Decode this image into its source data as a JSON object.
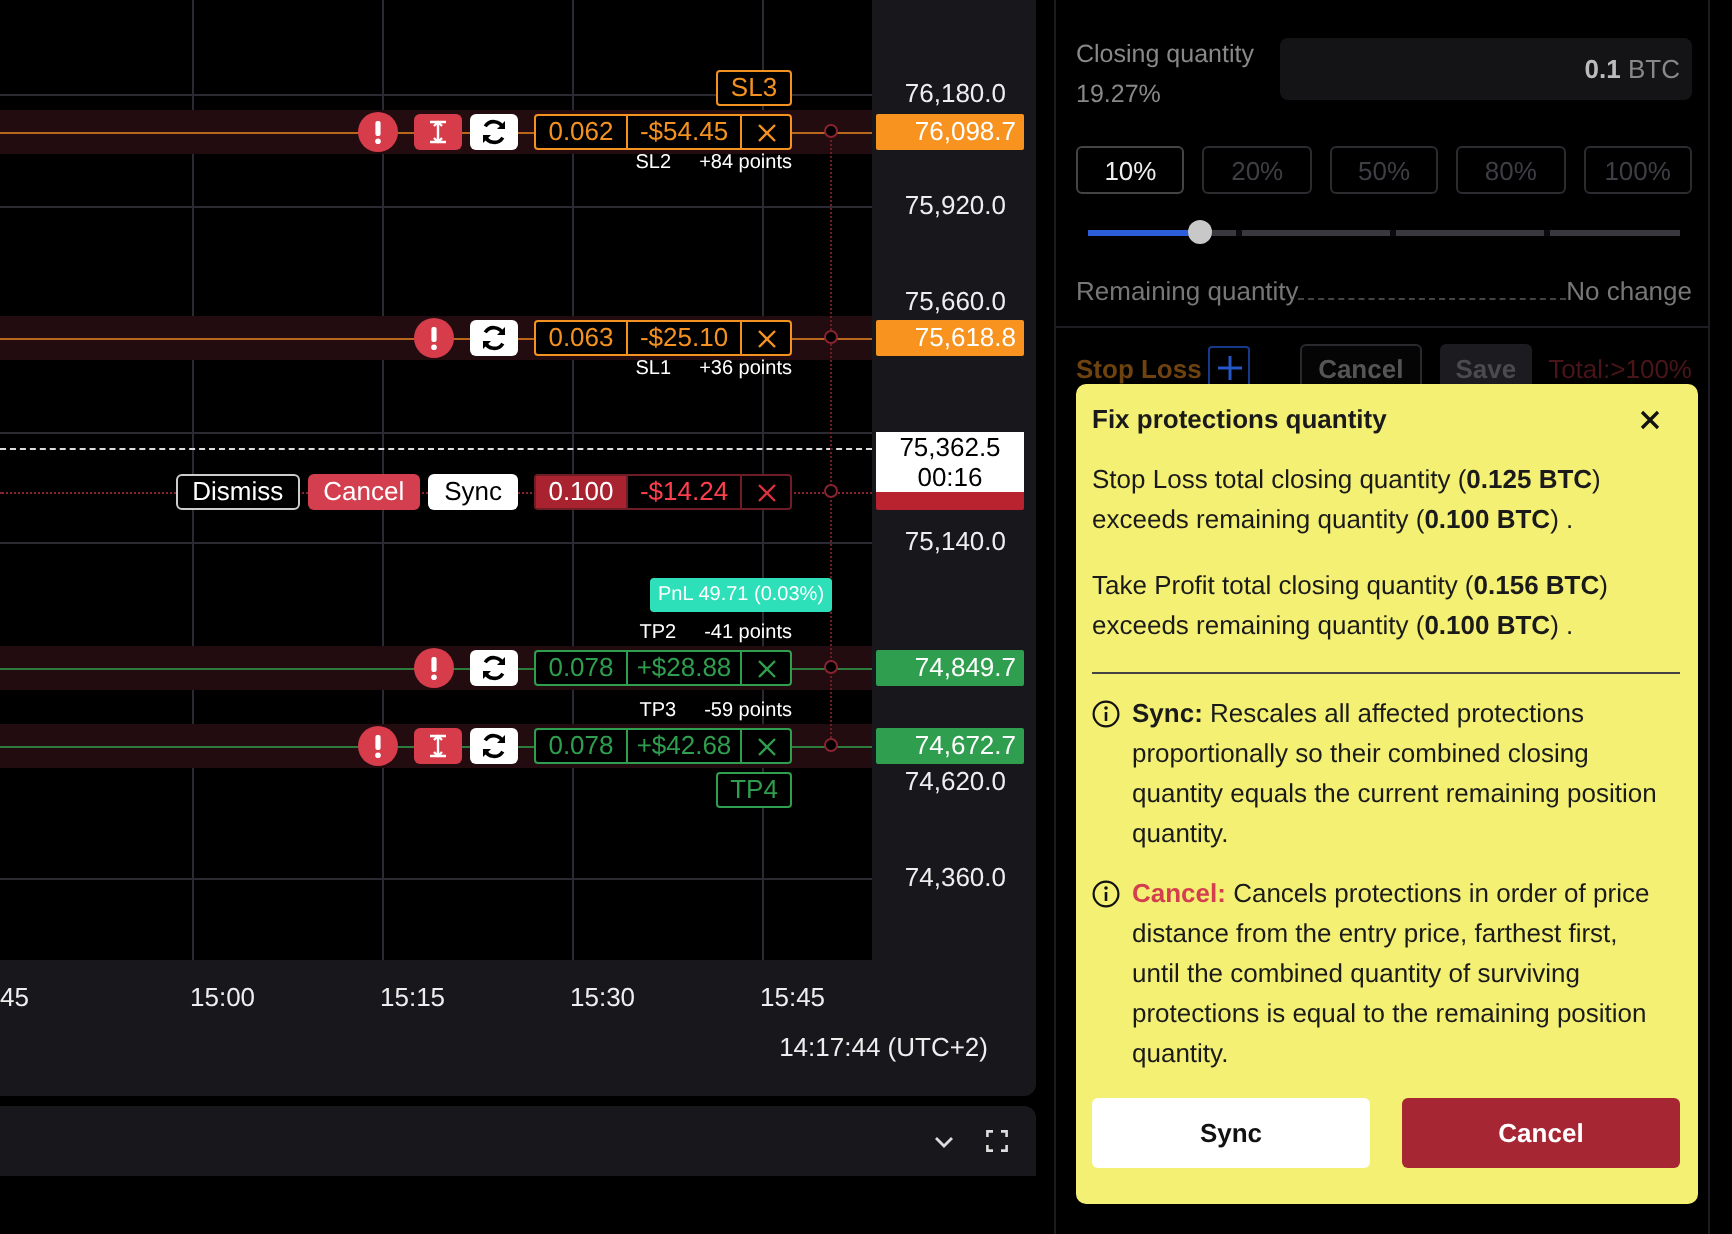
{
  "chart": {
    "price_ticks": [
      "76,180.0",
      "75,920.0",
      "75,660.0",
      "75,140.0",
      "74,620.0",
      "74,360.0"
    ],
    "time_ticks": [
      "45",
      "15:00",
      "15:15",
      "15:30",
      "15:45"
    ],
    "clock": "14:17:44 (UTC+2)",
    "current_price": {
      "price": "75,362.5",
      "countdown": "00:16"
    },
    "pnl_badge": "PnL 49.71 (0.03%)",
    "pending_tags": [
      {
        "kind": "stop_loss",
        "label": "SL3"
      },
      {
        "kind": "take_profit",
        "label": "TP4"
      }
    ],
    "orders": [
      {
        "kind": "stop_loss",
        "name": "SL2",
        "points": "+84 points",
        "quantity": "0.062",
        "pnl": "-$54.45",
        "price": "76,098.7",
        "warning": true,
        "range_button": true
      },
      {
        "kind": "stop_loss",
        "name": "SL1",
        "points": "+36 points",
        "quantity": "0.063",
        "pnl": "-$25.10",
        "price": "75,618.8",
        "warning": true,
        "range_button": false
      },
      {
        "kind": "take_profit",
        "name": "TP2",
        "points": "-41 points",
        "quantity": "0.078",
        "pnl": "+$28.88",
        "price": "74,849.7",
        "warning": true,
        "range_button": false
      },
      {
        "kind": "take_profit",
        "name": "TP3",
        "points": "-59 points",
        "quantity": "0.078",
        "pnl": "+$42.68",
        "price": "74,672.7",
        "warning": true,
        "range_button": true
      }
    ],
    "entry": {
      "buttons": [
        {
          "kind": "dismiss",
          "label": "Dismiss"
        },
        {
          "kind": "cancel",
          "label": "Cancel"
        },
        {
          "kind": "sync",
          "label": "Sync"
        }
      ],
      "quantity": "0.100",
      "pnl": "-$14.24"
    }
  },
  "order_form": {
    "closing_label": "Closing quantity",
    "closing_percent": "19.27%",
    "amount": "0.1",
    "unit": "BTC",
    "presets": [
      {
        "label": "10%",
        "selected": true
      },
      {
        "label": "20%",
        "selected": false
      },
      {
        "label": "50%",
        "selected": false
      },
      {
        "label": "80%",
        "selected": false
      },
      {
        "label": "100%",
        "selected": false
      }
    ],
    "slider": {
      "level": 0.19
    },
    "remaining_label": "Remaining quantity",
    "remaining_value": "No change",
    "stop_loss": {
      "title": "Stop Loss",
      "cancel": "Cancel",
      "save": {
        "label": "Save",
        "disabled": true
      },
      "total": "Total:>100%"
    }
  },
  "popover": {
    "title": "Fix protections quantity",
    "paragraphs": [
      "Stop Loss total closing quantity (**0.125 BTC**) exceeds remaining quantity (**0.100 BTC**) .",
      "Take Profit total closing quantity (**0.156 BTC**) exceeds remaining quantity (**0.100 BTC**) ."
    ],
    "notes": [
      {
        "kind": "sync",
        "label": "Sync:",
        "text": "Rescales all affected protections proportionally so their combined closing quantity equals the current remaining position quantity."
      },
      {
        "kind": "cancel",
        "label": "Cancel:",
        "text": "Cancels protections in order of price distance from the entry price, farthest first, until the combined quantity of surviving protections is equal to the remaining position quantity."
      }
    ],
    "buttons": [
      {
        "kind": "sync",
        "label": "Sync"
      },
      {
        "kind": "cancel",
        "label": "Cancel"
      }
    ]
  }
}
